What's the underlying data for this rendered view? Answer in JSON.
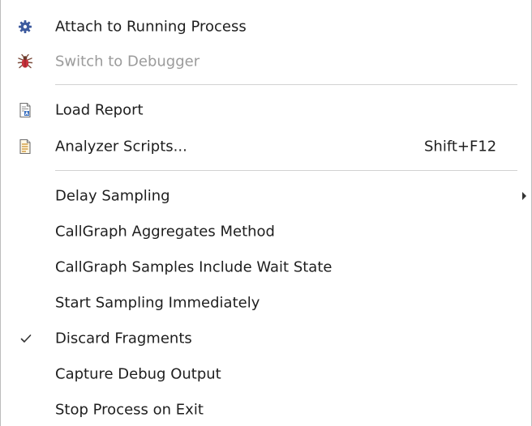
{
  "menu": {
    "items": [
      {
        "label": "Attach to Running Process",
        "icon": "gear-icon",
        "enabled": true
      },
      {
        "label": "Switch to Debugger",
        "icon": "bug-icon",
        "enabled": false
      },
      {
        "label": "Load Report",
        "icon": "report-document-icon",
        "enabled": true
      },
      {
        "label": "Analyzer Scripts...",
        "icon": "script-document-icon",
        "shortcut": "Shift+F12",
        "enabled": true
      },
      {
        "label": "Delay Sampling",
        "submenu": true,
        "enabled": true
      },
      {
        "label": "CallGraph Aggregates Method",
        "enabled": true
      },
      {
        "label": "CallGraph Samples Include Wait State",
        "enabled": true
      },
      {
        "label": "Start Sampling Immediately",
        "enabled": true
      },
      {
        "label": "Discard Fragments",
        "checked": true,
        "enabled": true
      },
      {
        "label": "Capture Debug Output",
        "enabled": true
      },
      {
        "label": "Stop Process on Exit",
        "enabled": true
      }
    ]
  },
  "colors": {
    "text": "#1e1e1e",
    "disabled_text": "#9b9b9b",
    "separator": "#d2d2d2",
    "border": "#bcbcbc"
  }
}
